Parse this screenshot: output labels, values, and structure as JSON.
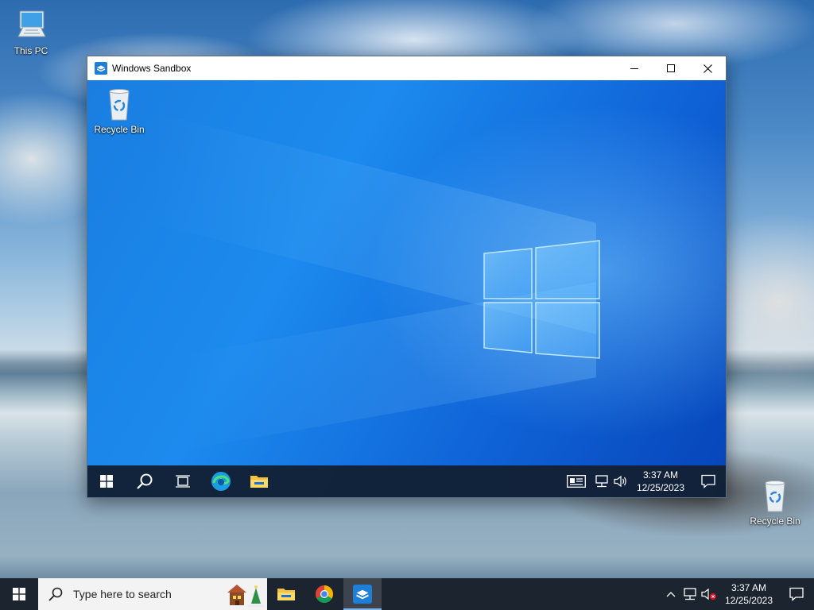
{
  "desktop": {
    "icons": [
      {
        "label": "This PC"
      },
      {
        "label": "Recycle Bin"
      }
    ]
  },
  "sandbox_window": {
    "title": "Windows Sandbox",
    "desktop_icons": [
      {
        "label": "Recycle Bin"
      }
    ],
    "taskbar": {
      "clock_time": "3:37 AM",
      "clock_date": "12/25/2023"
    }
  },
  "host_taskbar": {
    "search_placeholder": "Type here to search",
    "clock_time": "3:37 AM",
    "clock_date": "12/25/2023"
  },
  "colors": {
    "accent": "#0078d7",
    "taskbar": "#1c2430",
    "sandbox_taskbar": "#12203a"
  }
}
